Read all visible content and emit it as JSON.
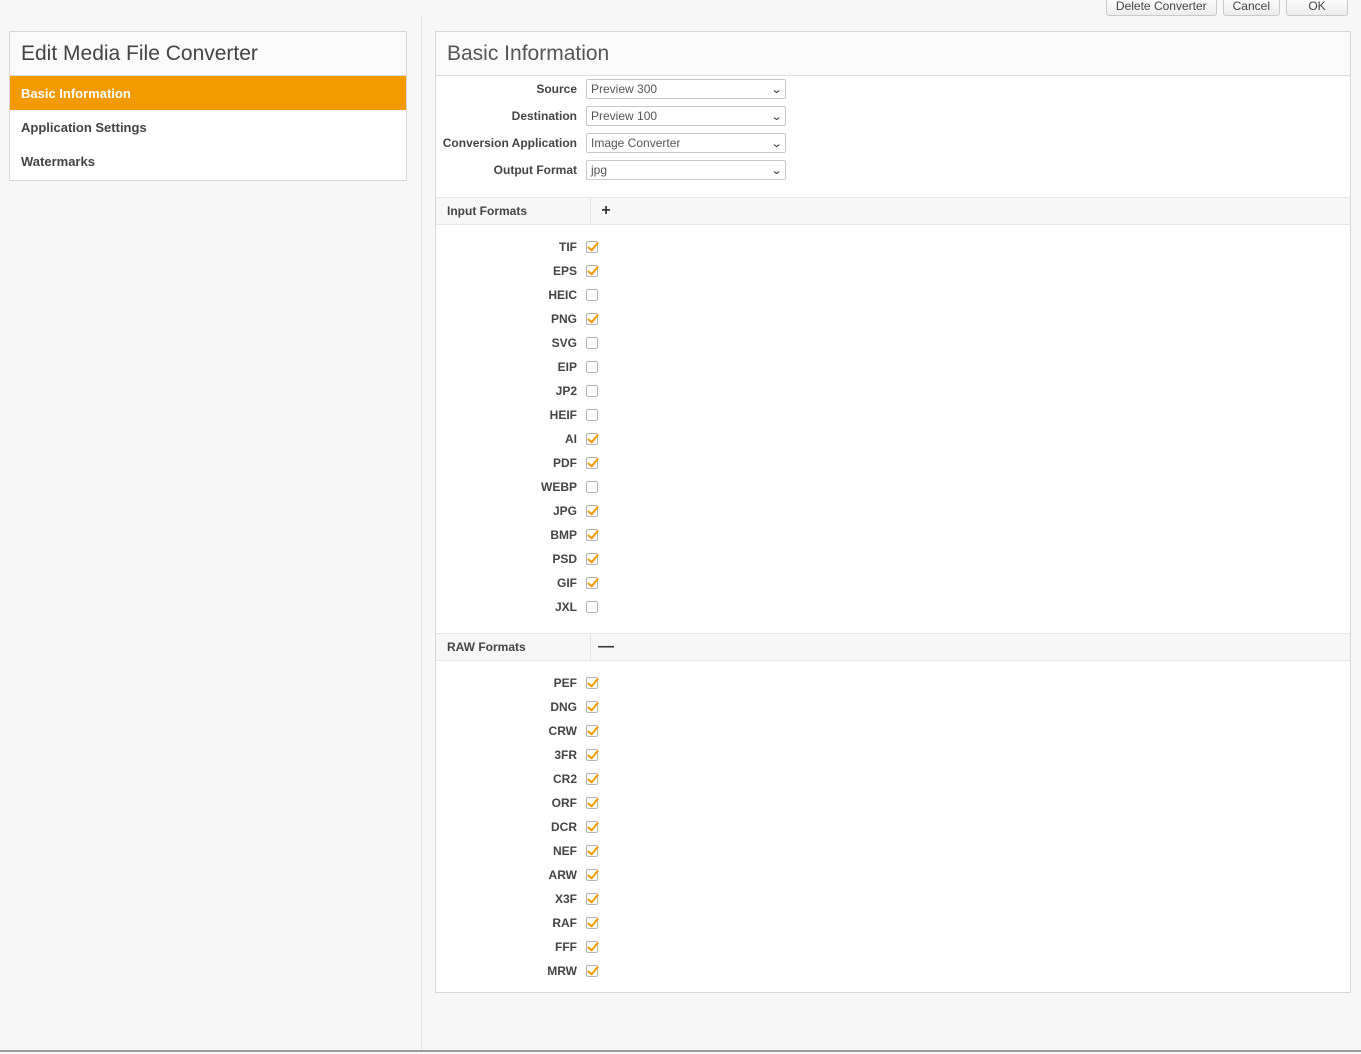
{
  "toolbar": {
    "delete_label": "Delete Converter",
    "cancel_label": "Cancel",
    "ok_label": "OK"
  },
  "sidebar": {
    "title": "Edit Media File Converter",
    "items": [
      {
        "label": "Basic Information",
        "active": true
      },
      {
        "label": "Application Settings",
        "active": false
      },
      {
        "label": "Watermarks",
        "active": false
      }
    ]
  },
  "main": {
    "title": "Basic Information",
    "fields": [
      {
        "label": "Source",
        "value": "Preview 300"
      },
      {
        "label": "Destination",
        "value": "Preview 100"
      },
      {
        "label": "Conversion Application",
        "value": "Image Converter"
      },
      {
        "label": "Output Format",
        "value": "jpg"
      }
    ],
    "input_formats": {
      "label": "Input Formats",
      "toggle": "+",
      "items": [
        {
          "label": "TIF",
          "checked": true
        },
        {
          "label": "EPS",
          "checked": true
        },
        {
          "label": "HEIC",
          "checked": false
        },
        {
          "label": "PNG",
          "checked": true
        },
        {
          "label": "SVG",
          "checked": false
        },
        {
          "label": "EIP",
          "checked": false
        },
        {
          "label": "JP2",
          "checked": false
        },
        {
          "label": "HEIF",
          "checked": false
        },
        {
          "label": "AI",
          "checked": true
        },
        {
          "label": "PDF",
          "checked": true
        },
        {
          "label": "WEBP",
          "checked": false
        },
        {
          "label": "JPG",
          "checked": true
        },
        {
          "label": "BMP",
          "checked": true
        },
        {
          "label": "PSD",
          "checked": true
        },
        {
          "label": "GIF",
          "checked": true
        },
        {
          "label": "JXL",
          "checked": false
        }
      ]
    },
    "raw_formats": {
      "label": "RAW Formats",
      "toggle": "—",
      "items": [
        {
          "label": "PEF",
          "checked": true
        },
        {
          "label": "DNG",
          "checked": true
        },
        {
          "label": "CRW",
          "checked": true
        },
        {
          "label": "3FR",
          "checked": true
        },
        {
          "label": "CR2",
          "checked": true
        },
        {
          "label": "ORF",
          "checked": true
        },
        {
          "label": "DCR",
          "checked": true
        },
        {
          "label": "NEF",
          "checked": true
        },
        {
          "label": "ARW",
          "checked": true
        },
        {
          "label": "X3F",
          "checked": true
        },
        {
          "label": "RAF",
          "checked": true
        },
        {
          "label": "FFF",
          "checked": true
        },
        {
          "label": "MRW",
          "checked": true
        }
      ]
    }
  },
  "colors": {
    "accent": "#f39a00"
  }
}
